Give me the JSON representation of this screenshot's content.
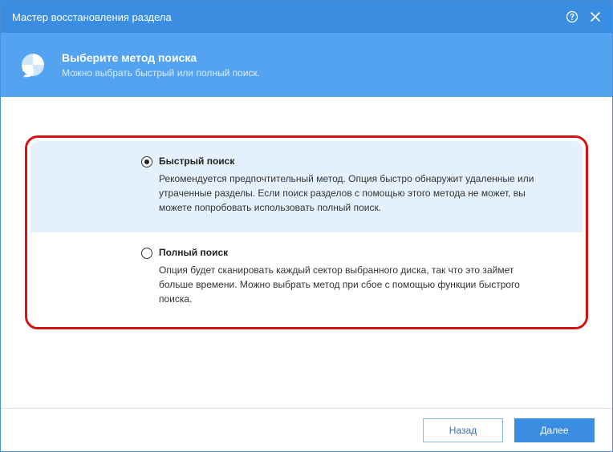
{
  "titlebar": {
    "title": "Мастер восстановления раздела"
  },
  "header": {
    "heading": "Выберите метод поиска",
    "sub": "Можно выбрать быстрый или полный поиск."
  },
  "options": {
    "quick": {
      "title": "Быстрый поиск",
      "desc": "Рекомендуется предпочтительный метод. Опция быстро обнаружит удаленные или утраченные разделы. Если поиск разделов с помощью этого метода не может, вы можете попробовать использовать полный поиск.",
      "selected": true
    },
    "full": {
      "title": "Полный поиск",
      "desc": "Опция будет сканировать каждый сектор выбранного диска, так что это займет больше времени. Можно выбрать метод при сбое с помощью функции быстрого поиска.",
      "selected": false
    }
  },
  "footer": {
    "back": "Назад",
    "next": "Далее"
  },
  "colors": {
    "accent": "#3a8de0",
    "highlight": "#d31414"
  }
}
